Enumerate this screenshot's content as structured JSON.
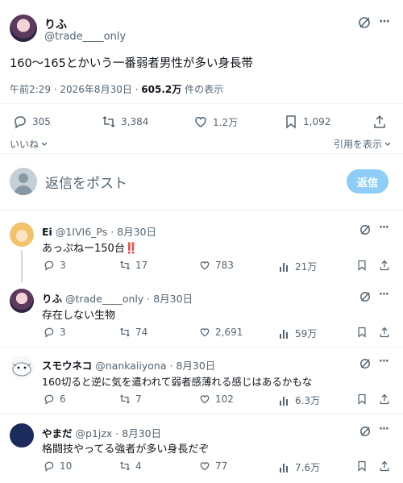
{
  "main_post": {
    "display_name": "りふ",
    "handle": "@trade____only",
    "text": "160～165とかいう一番弱者男性が多い身長帯",
    "time": "午前2:29 · 2026年8月30日 · ",
    "views_count": "605.2万",
    "views_label": " 件の表示",
    "stats": {
      "replies": "305",
      "reposts": "3,384",
      "likes": "1.2万",
      "bookmarks": "1,092"
    },
    "like_dropdown_label": "いいね",
    "quote_label": "引用を表示"
  },
  "reply_box": {
    "placeholder": "返信をポスト",
    "button_label": "返信"
  },
  "replies": [
    {
      "display_name": "Ei",
      "handle": "@1IVI6_Ps",
      "date": "8月30日",
      "text": "あっぷねー150台",
      "emphasis": "‼️",
      "replies": "3",
      "reposts": "17",
      "likes": "783",
      "views": "21万"
    },
    {
      "display_name": "りふ",
      "handle": "@trade____only",
      "date": "8月30日",
      "text": "存在しない生物",
      "replies": "3",
      "reposts": "74",
      "likes": "2,691",
      "views": "59万"
    },
    {
      "display_name": "スモウネコ",
      "handle": "@nankaiiyona",
      "date": "8月30日",
      "text": "160切ると逆に気を遣われて弱者感薄れる感じはあるかもな",
      "replies": "6",
      "reposts": "7",
      "likes": "102",
      "views": "6.3万"
    },
    {
      "display_name": "やまだ",
      "handle": "@p1jzx",
      "date": "8月30日",
      "text": "格闘技やってる強者が多い身長だぞ",
      "replies": "10",
      "reposts": "4",
      "likes": "77",
      "views": "7.6万"
    }
  ],
  "separator": " · ",
  "more_glyph": "···",
  "colors": {
    "accent": "#1d9bf0",
    "reply_button_bg": "#8ecdf8",
    "muted_text": "#536471",
    "divider": "#eff3f4"
  }
}
